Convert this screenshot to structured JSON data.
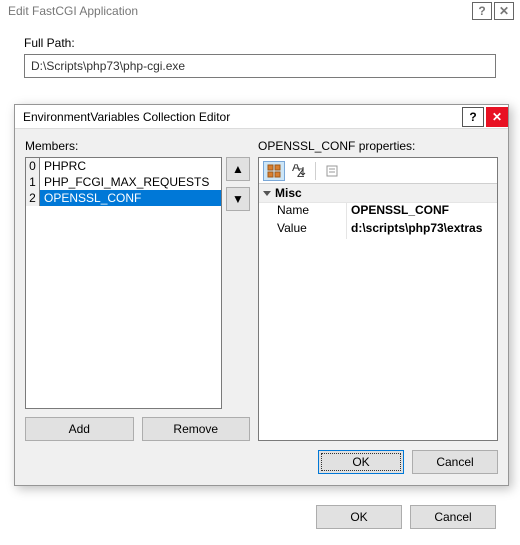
{
  "parent": {
    "title": "Edit FastCGI Application",
    "help_glyph": "?",
    "close_glyph": "✕",
    "full_path_label": "Full Path:",
    "full_path_value": "D:\\Scripts\\php73\\php-cgi.exe",
    "ok_label": "OK",
    "cancel_label": "Cancel"
  },
  "editor": {
    "title": "EnvironmentVariables Collection Editor",
    "help_glyph": "?",
    "close_glyph": "✕",
    "members_label": "Members:",
    "properties_label": "OPENSSL_CONF properties:",
    "add_label": "Add",
    "remove_label": "Remove",
    "ok_label": "OK",
    "cancel_label": "Cancel",
    "up_glyph": "▲",
    "down_glyph": "▼",
    "members": [
      {
        "index": "0",
        "name": "PHPRC",
        "selected": false
      },
      {
        "index": "1",
        "name": "PHP_FCGI_MAX_REQUESTS",
        "selected": false
      },
      {
        "index": "2",
        "name": "OPENSSL_CONF",
        "selected": true
      }
    ],
    "prop_category": "Misc",
    "prop_name_key": "Name",
    "prop_name_value": "OPENSSL_CONF",
    "prop_value_key": "Value",
    "prop_value_value": "d:\\scripts\\php73\\extras"
  }
}
